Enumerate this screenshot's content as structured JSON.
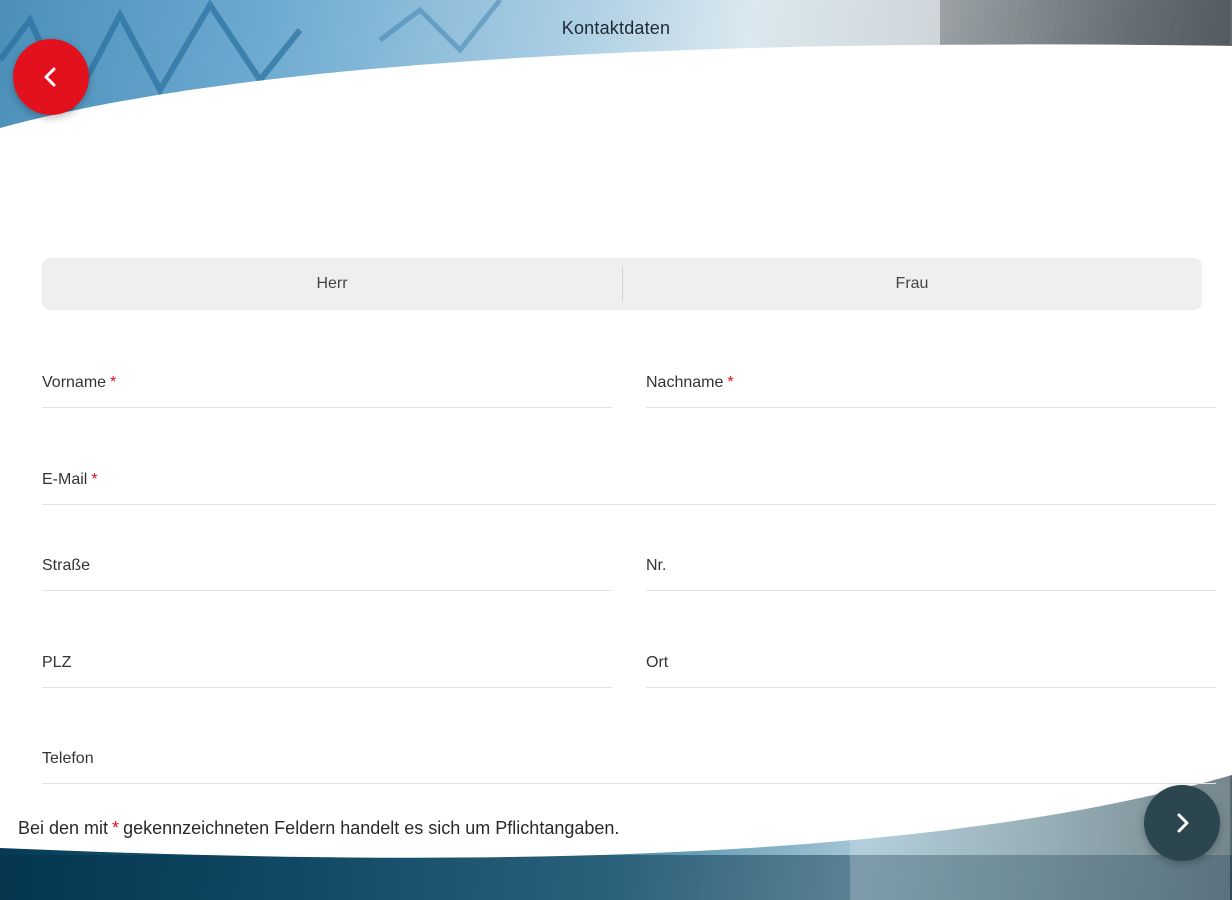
{
  "header": {
    "title": "Kontaktdaten"
  },
  "nav": {
    "back_icon": "chevron-left-icon",
    "next_icon": "chevron-right-icon"
  },
  "salutation": {
    "options": [
      "Herr",
      "Frau"
    ]
  },
  "fields": {
    "vorname": {
      "label": "Vorname",
      "required_mark": "*"
    },
    "nachname": {
      "label": "Nachname",
      "required_mark": "*"
    },
    "email": {
      "label": "E-Mail",
      "required_mark": "*"
    },
    "strasse": {
      "label": "Straße"
    },
    "nr": {
      "label": "Nr."
    },
    "plz": {
      "label": "PLZ"
    },
    "ort": {
      "label": "Ort"
    },
    "telefon": {
      "label": "Telefon"
    }
  },
  "footer": {
    "note_before": "Bei den mit",
    "note_mark": "*",
    "note_after": "gekennzeichneten Feldern handelt es sich um Pflichtangaben."
  },
  "colors": {
    "accent": "#e2111d",
    "next_button": "#2b464f",
    "segment_bg": "#efefef"
  }
}
